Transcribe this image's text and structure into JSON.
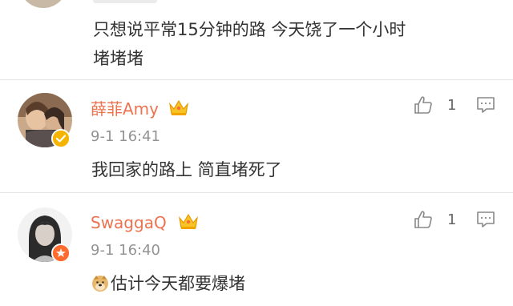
{
  "comments": [
    {
      "text_line1": "只想说平常15分钟的路 今天饶了一个小时",
      "text_line2": "堵堵堵"
    },
    {
      "username": "薛菲Amy",
      "time": "9-1 16:41",
      "text": "我回家的路上 简直堵死了",
      "likes": "1",
      "badge": "crown-vip",
      "verify": "verified-yellow"
    },
    {
      "username": "SwaggaQ",
      "time": "9-1 16:40",
      "text": "估计今天都要爆堵",
      "likes": "1",
      "badge": "crown-vip",
      "verify": "verified-orange",
      "emoji": "doge-emoji"
    }
  ],
  "colors": {
    "username": "#eb7350",
    "time": "#939393",
    "text": "#333333",
    "icon": "#888888",
    "divider": "#e6e6e6"
  }
}
